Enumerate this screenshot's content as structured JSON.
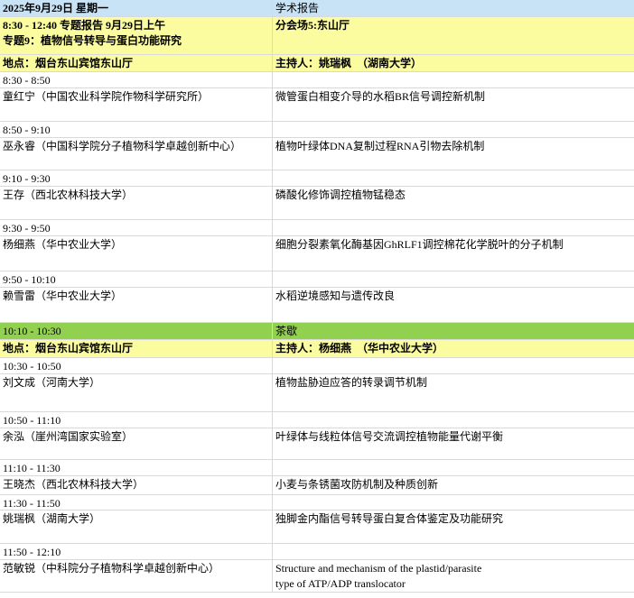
{
  "header": {
    "date": "2025年9月29日 星期一",
    "category": "学术报告"
  },
  "session1": {
    "time_line": "8:30 - 12:40 专题报告 9月29日上午",
    "topic": "专题9：植物信号转导与蛋白功能研究",
    "venue": "地点：烟台东山宾馆东山厅",
    "hall": "分会场5:东山厅",
    "host": "主持人：姚瑞枫　（湖南大学）"
  },
  "talks1": [
    {
      "time": "8:30 - 8:50",
      "speaker": "童红宁（中国农业科学院作物科学研究所）",
      "title": "微管蛋白相变介导的水稻BR信号调控新机制"
    },
    {
      "time": "8:50 - 9:10",
      "speaker": "巫永睿（中国科学院分子植物科学卓越创新中心）",
      "title": "植物叶绿体DNA复制过程RNA引物去除机制"
    },
    {
      "time": "9:10 - 9:30",
      "speaker": "王存（西北农林科技大学）",
      "title": "磷酸化修饰调控植物锰稳态"
    },
    {
      "time": "9:30 - 9:50",
      "speaker": "杨细燕（华中农业大学）",
      "title": "细胞分裂素氧化酶基因GhRLF1调控棉花化学脱叶的分子机制"
    },
    {
      "time": "9:50 - 10:10",
      "speaker": "赖雪雷（华中农业大学）",
      "title": "水稻逆境感知与遗传改良"
    }
  ],
  "break": {
    "time": "10:10 - 10:30",
    "label": "茶歇"
  },
  "session2": {
    "venue": "地点：烟台东山宾馆东山厅",
    "host": "主持人：杨细燕　（华中农业大学）"
  },
  "talks2": [
    {
      "time": "10:30 - 10:50",
      "speaker": "刘文成（河南大学）",
      "title": "植物盐胁迫应答的转录调节机制"
    },
    {
      "time": "10:50 - 11:10",
      "speaker": "余泓（崖州湾国家实验室）",
      "title": "叶绿体与线粒体信号交流调控植物能量代谢平衡"
    },
    {
      "time": "11:10 - 11:30",
      "speaker": "王晓杰（西北农林科技大学）",
      "title": "小麦与条锈菌攻防机制及种质创新"
    },
    {
      "time": "11:30 - 11:50",
      "speaker": "姚瑞枫（湖南大学）",
      "title": "独脚金内酯信号转导蛋白复合体鉴定及功能研究"
    },
    {
      "time": "11:50 - 12:10",
      "speaker": "范敏锐（中科院分子植物科学卓越创新中心）",
      "title": "Structure and mechanism of the plastid/parasite",
      "title_line2": "type of ATP/ADP translocator"
    }
  ]
}
